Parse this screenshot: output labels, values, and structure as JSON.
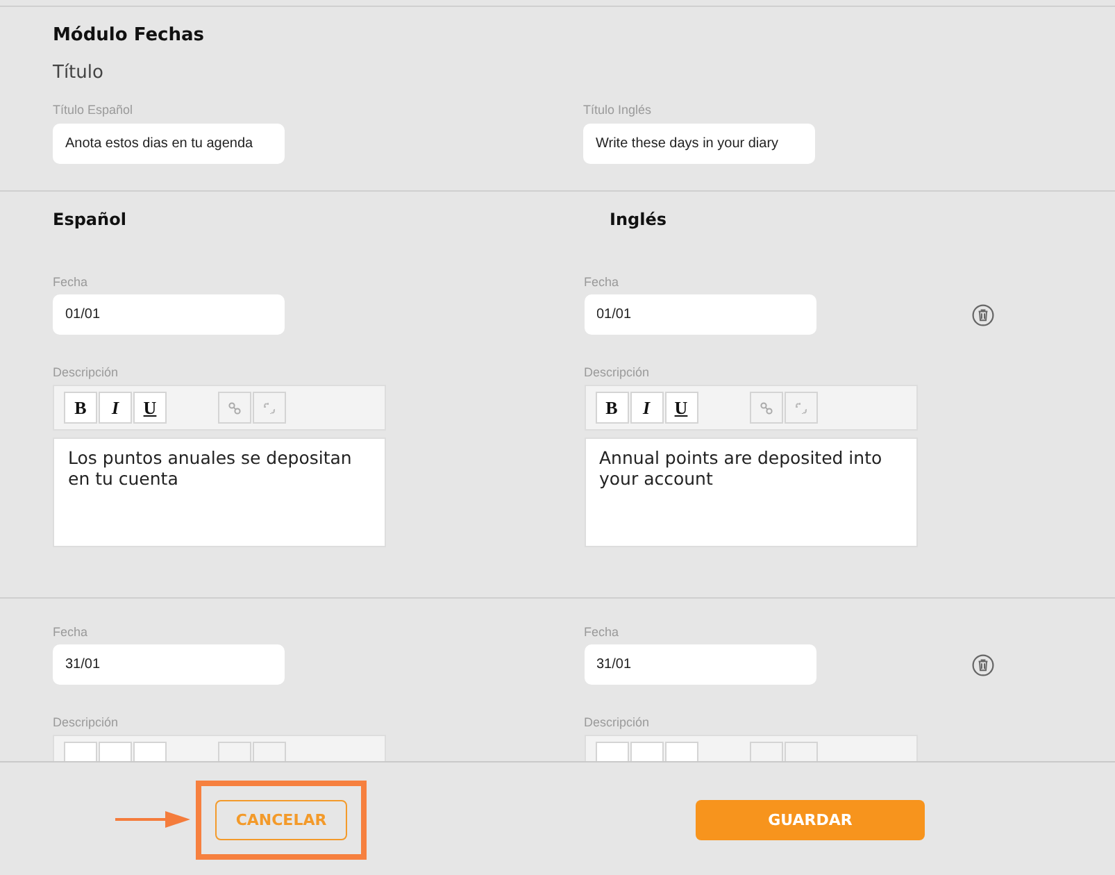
{
  "module": {
    "title": "Módulo Fechas",
    "subtitle": "Título",
    "fields": [
      {
        "label": "Título Español",
        "value": "Anota estos dias en tu agenda"
      },
      {
        "label": "Título Inglés",
        "value": "Write these days in your diary"
      }
    ]
  },
  "columns": [
    "Español",
    "Inglés"
  ],
  "entries": [
    {
      "cells": [
        {
          "date_label": "Fecha",
          "date": "01/01",
          "description_label": "Descripción",
          "format": [
            "B",
            "I",
            "U"
          ],
          "description": "Los puntos anuales se depositan en tu cuenta"
        },
        {
          "date_label": "Fecha",
          "date": "01/01",
          "description_label": "Descripción",
          "format": [
            "B",
            "I",
            "U"
          ],
          "description": "Annual points are deposited into your account"
        }
      ]
    },
    {
      "cells": [
        {
          "date_label": "Fecha",
          "date": "31/01",
          "description_label": "Descripción"
        },
        {
          "date_label": "Fecha",
          "date": "31/01",
          "description_label": "Descripción"
        }
      ]
    }
  ],
  "footer": {
    "cancel": "CANCELAR",
    "save": "GUARDAR",
    "cancel_highlighted": true
  }
}
